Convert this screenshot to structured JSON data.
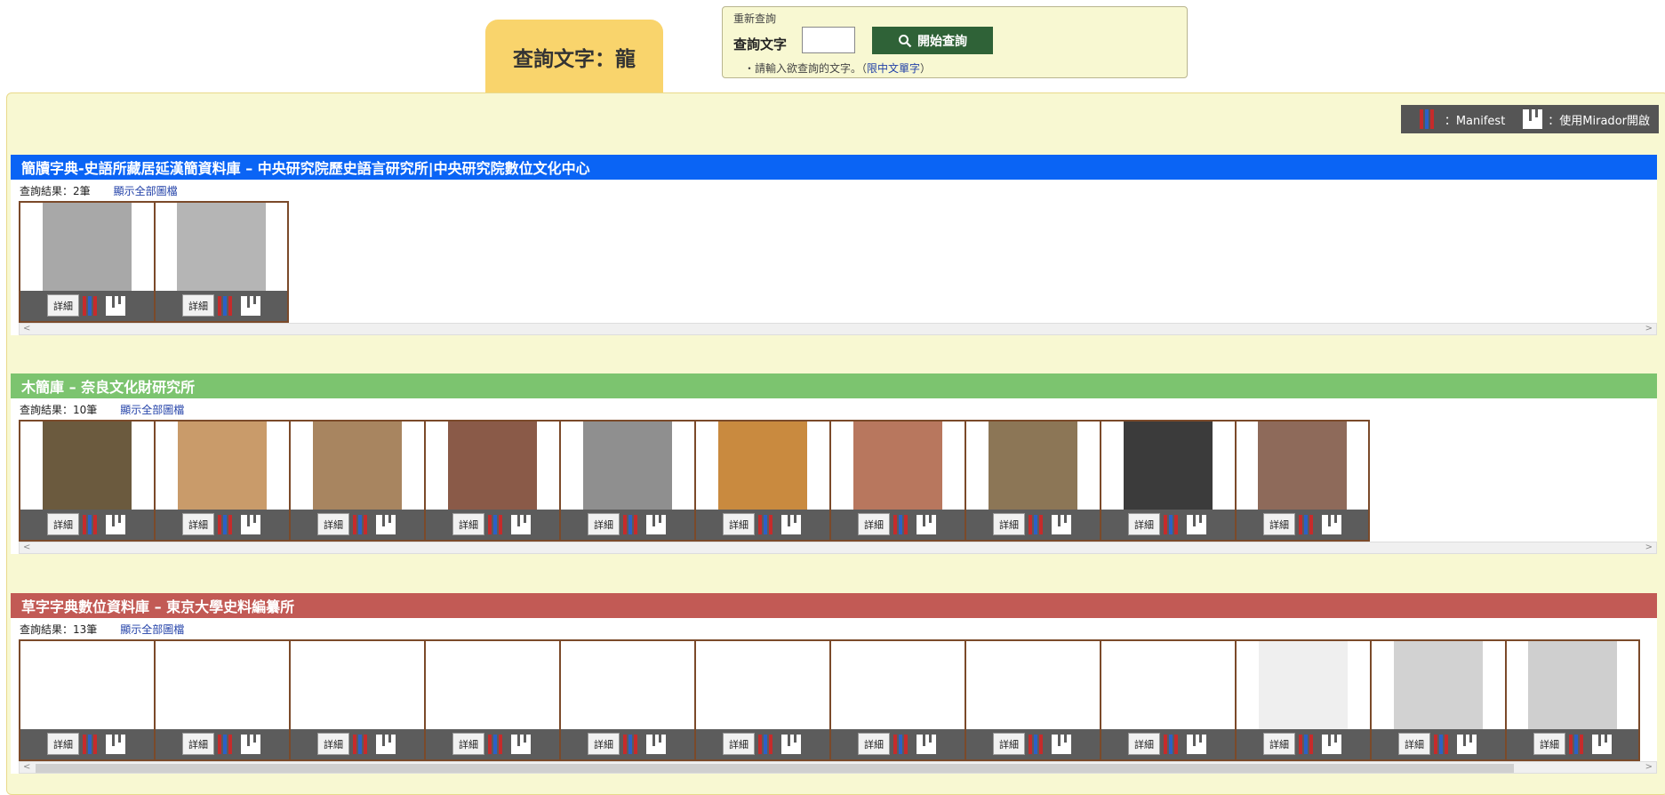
{
  "header": {
    "title": "查詢文字：龍"
  },
  "search": {
    "legend": "重新查詢",
    "label": "查詢文字",
    "input_value": "",
    "button_label": "開始查詢",
    "hint_prefix": "・請輸入欲查詢的文字。（",
    "hint_limit": "限中文單字",
    "hint_suffix": "）"
  },
  "legend_bar": {
    "manifest_label": "：Manifest",
    "mirador_label": "：使用Mirador開啟"
  },
  "common": {
    "detail_label": "詳細",
    "result_prefix": "查詢結果：",
    "show_all_label": "顯示全部圖檔"
  },
  "sections": [
    {
      "title": "簡牘字典-史語所藏居延漢簡資料庫 – 中央研究院歷史語言研究所|中央研究院數位文化中心",
      "header_color": "#0a64f5",
      "result_count": "2筆",
      "thumb_count": 2
    },
    {
      "title": "木簡庫 – 奈良文化財研究所",
      "header_color": "#7cc46f",
      "result_count": "10筆",
      "thumb_count": 10
    },
    {
      "title": "草字字典數位資料庫 – 東京大學史料編纂所",
      "header_color": "#c25a55",
      "result_count": "13筆",
      "thumb_count": 13
    }
  ],
  "colors": {
    "manifest_red": "#c62b2b",
    "manifest_blue": "#2b61c6"
  }
}
